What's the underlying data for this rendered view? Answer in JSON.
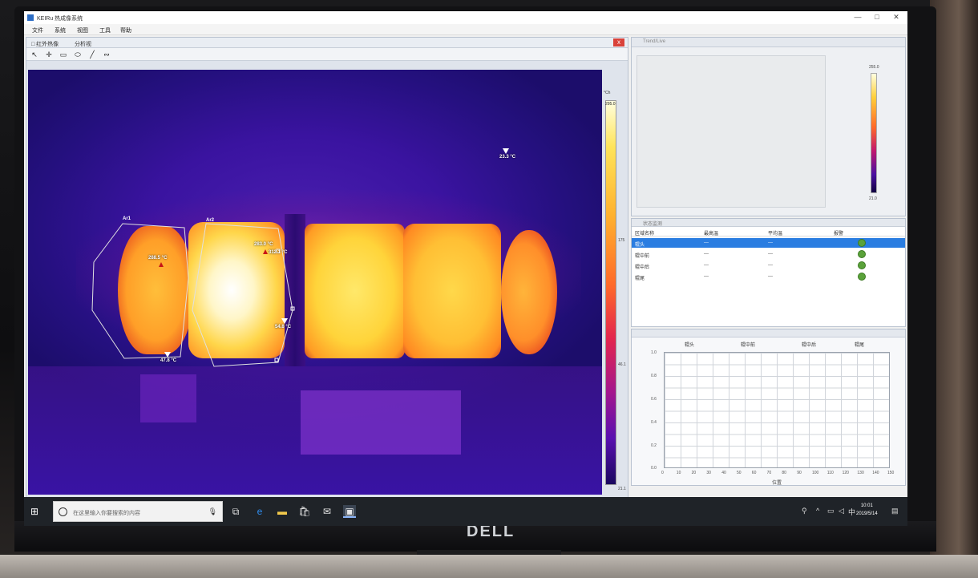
{
  "window": {
    "title": "KEIRu 热成像系统",
    "minimize": "—",
    "maximize": "□",
    "close": "✕"
  },
  "menu": [
    "文件",
    "系统",
    "视图",
    "工具",
    "帮助"
  ],
  "image_pane": {
    "tabs": [
      "□ 红外热像",
      "分析视"
    ],
    "close": "x",
    "tools": [
      "pointer-icon",
      "crosshair-icon",
      "rectangle-icon",
      "ellipse-icon",
      "line-icon",
      "polyline-icon"
    ],
    "tool_glyphs": [
      "↖",
      "✛",
      "▭",
      "⬭",
      "╱",
      "∾"
    ]
  },
  "thermal_image": {
    "roi_labels": [
      "Ar1",
      "Ar2"
    ],
    "markers": {
      "background": "23.3 °C",
      "ar1_min": "47.8 °C",
      "ar1_max": "288.5 °C",
      "ar2_max": "283.0 °C",
      "ar2_point_a": "312.1 °C",
      "ar2_min": "54.8 °C"
    }
  },
  "color_scale": {
    "top": "295.0",
    "label_mid": "175",
    "label_low": "46.1",
    "bottom": "21.1",
    "unit": "°Ch"
  },
  "preview_pane": {
    "title": "Trend/Live",
    "scale_top": "255.0",
    "scale_bottom": "21.0"
  },
  "status_table": {
    "title": "状态监测",
    "headers": [
      "区域名称",
      "最高温",
      "平均温",
      "报警"
    ],
    "rows": [
      {
        "name": "辊头",
        "max": "---",
        "avg": "---"
      },
      {
        "name": "辊中前",
        "max": "---",
        "avg": "---"
      },
      {
        "name": "辊中后",
        "max": "---",
        "avg": "---"
      },
      {
        "name": "辊尾",
        "max": "---",
        "avg": "---"
      }
    ]
  },
  "chart": {
    "columns": [
      "辊头",
      "辊中前",
      "辊中后",
      "辊尾"
    ],
    "yticks": [
      "1.0",
      "0.8",
      "0.6",
      "0.4",
      "0.2",
      "0.0"
    ],
    "xticks": [
      "0",
      "10",
      "20",
      "30",
      "40",
      "50",
      "60",
      "70",
      "80",
      "90",
      "100",
      "110",
      "120",
      "130",
      "140",
      "150"
    ],
    "x_title": "位置"
  },
  "taskbar": {
    "search_placeholder": "在这里输入你要搜索的内容",
    "time": "10:01",
    "date": "2019/5/14"
  }
}
